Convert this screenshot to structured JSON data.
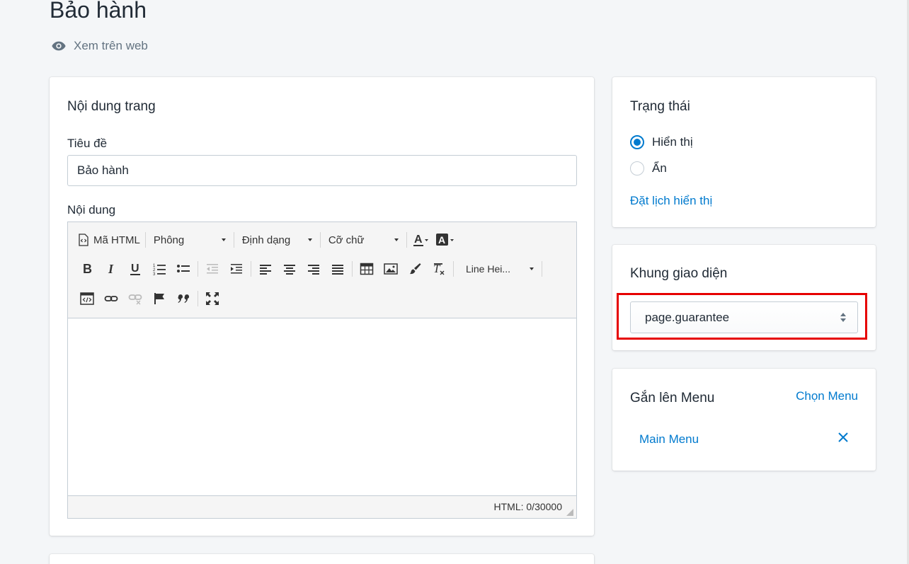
{
  "header": {
    "title": "Bảo hành",
    "view_web": "Xem trên web"
  },
  "content_card": {
    "title": "Nội dung trang",
    "title_label": "Tiêu đề",
    "title_value": "Bảo hành",
    "content_label": "Nội dung",
    "toolbar": {
      "html_label": "Mã HTML",
      "font_label": "Phông",
      "format_label": "Định dạng",
      "size_label": "Cỡ chữ",
      "line_height_label": "Line Hei..."
    },
    "char_count": "HTML: 0/30000"
  },
  "status_card": {
    "title": "Trạng thái",
    "options": [
      "Hiển thị",
      "Ẩn"
    ],
    "selected": "Hiển thị",
    "schedule_link": "Đặt lịch hiển thị"
  },
  "template_card": {
    "title": "Khung giao diện",
    "selected_template": "page.guarantee"
  },
  "menu_card": {
    "title": "Gắn lên Menu",
    "choose_link": "Chọn Menu",
    "items": [
      "Main Menu"
    ]
  },
  "colors": {
    "accent": "#007ace",
    "highlight": "#e60000",
    "background": "#f4f6f8"
  }
}
